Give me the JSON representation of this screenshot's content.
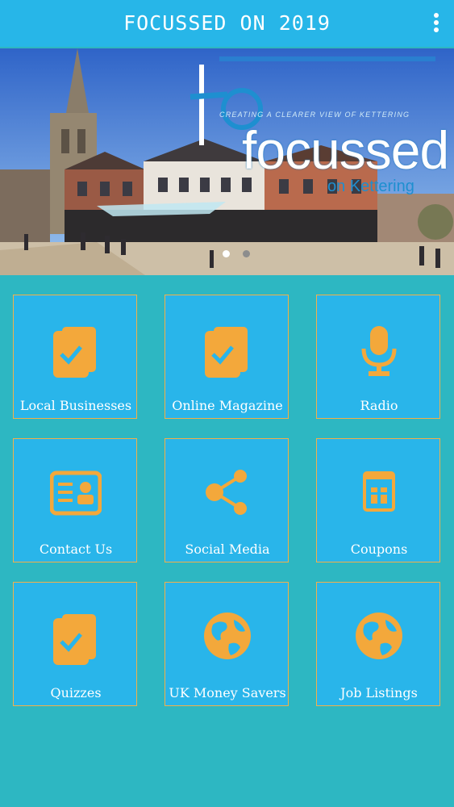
{
  "app_bar": {
    "title": "FOCUSSED ON 2019",
    "menu_icon": "more-vert-icon"
  },
  "banner": {
    "logo_tagline": "CREATING A CLEARER VIEW OF KETTERING",
    "logo_word": "focussed",
    "logo_sub": "on Kettering",
    "carousel_dots": 2,
    "active_dot": 1
  },
  "colors": {
    "app_bar": "#27b6e8",
    "background": "#2db7c2",
    "tile": "#29b5ea",
    "accent": "#f3b048"
  },
  "tiles": [
    {
      "label": "Local Businesses",
      "icon": "checklist-icon"
    },
    {
      "label": "Online Magazine",
      "icon": "checklist-icon"
    },
    {
      "label": "Radio",
      "icon": "microphone-icon"
    },
    {
      "label": "Contact Us",
      "icon": "contact-card-icon"
    },
    {
      "label": "Social Media",
      "icon": "share-icon"
    },
    {
      "label": "Coupons",
      "icon": "gift-book-icon"
    },
    {
      "label": "Quizzes",
      "icon": "checklist-icon"
    },
    {
      "label": "UK Money Savers",
      "icon": "globe-icon"
    },
    {
      "label": "Job Listings",
      "icon": "globe-icon"
    }
  ]
}
